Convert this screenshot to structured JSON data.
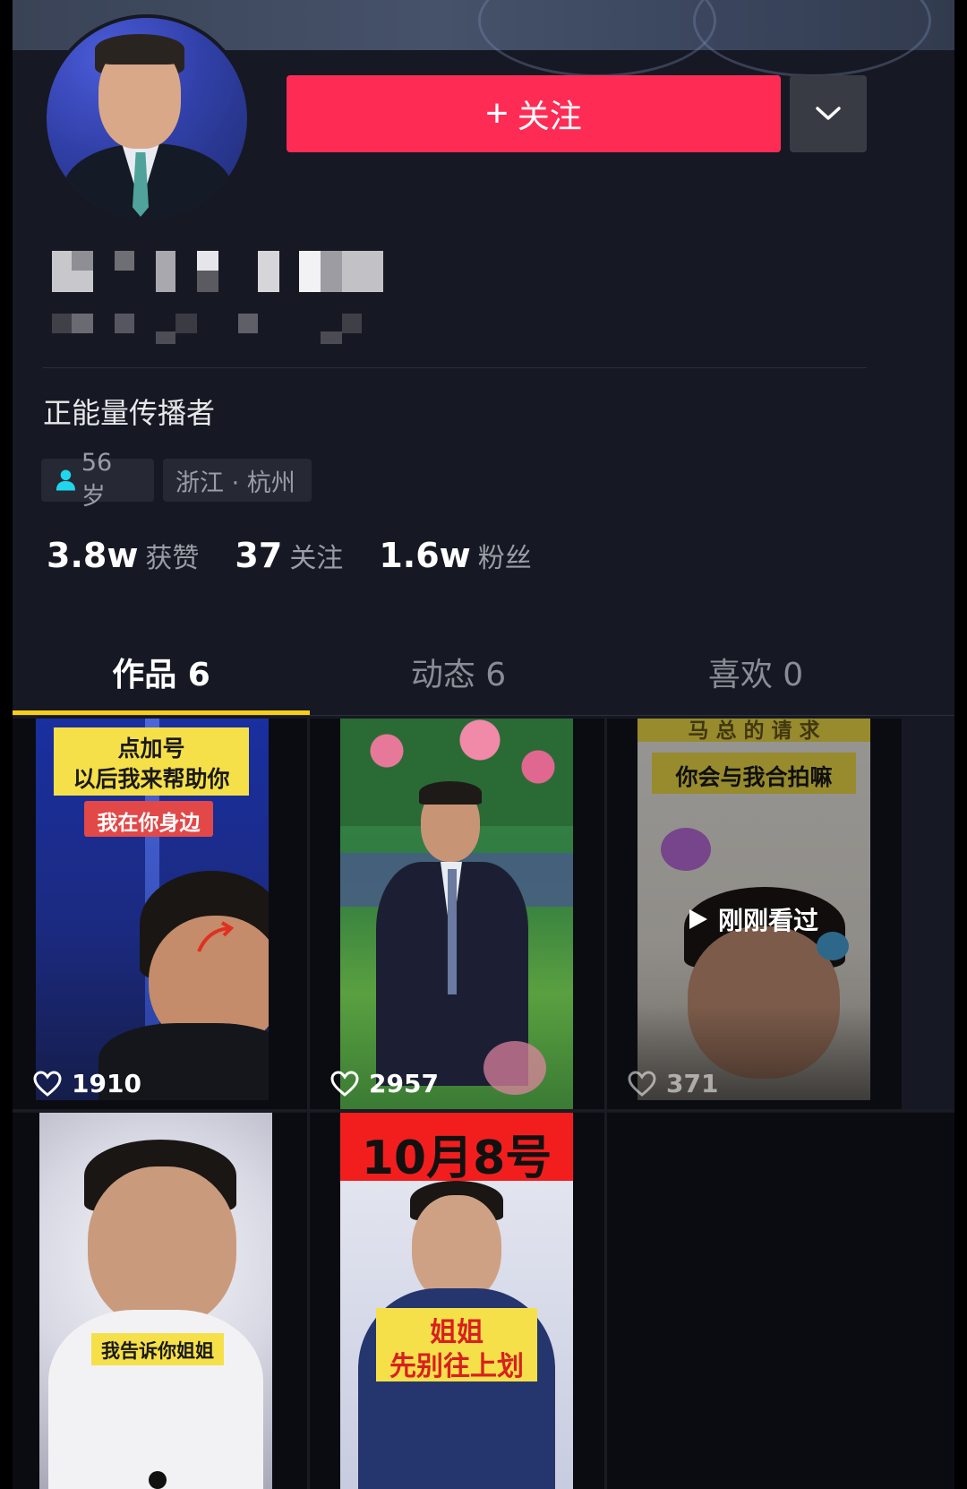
{
  "profile": {
    "follow_label": "关注",
    "bio": "正能量传播者",
    "age_tag": "56 岁",
    "location_tag": "浙江 · 杭州"
  },
  "stats": [
    {
      "value": "3.8w",
      "label": "获赞"
    },
    {
      "value": "37",
      "label": "关注"
    },
    {
      "value": "1.6w",
      "label": "粉丝"
    }
  ],
  "tabs": [
    {
      "label": "作品 6",
      "active": true
    },
    {
      "label": "动态 6",
      "active": false
    },
    {
      "label": "喜欢 0",
      "active": false
    }
  ],
  "videos": [
    {
      "likes": "1910",
      "caption_top": "点加号",
      "caption_mid": "以后我来帮助你",
      "caption_red": "我在你身边"
    },
    {
      "likes": "2957"
    },
    {
      "likes": "371",
      "caption_top": "马 总 的 请 求",
      "caption_mid": "你会与我合拍嘛",
      "viewed": "刚刚看过"
    },
    {
      "caption_bottom": "我告诉你姐姐"
    },
    {
      "caption_top": "10月8号",
      "caption_bottom_1": "姐姐",
      "caption_bottom_2": "先别往上划"
    }
  ],
  "icons": {
    "follow": "plus-icon",
    "more": "chevron-down-icon",
    "age": "person-icon",
    "like": "heart-outline-icon",
    "play": "play-icon"
  },
  "colors": {
    "follow_button": "#fe2c55",
    "background": "#161823",
    "tab_indicator": "#face15",
    "person_icon": "#20d5ec"
  }
}
